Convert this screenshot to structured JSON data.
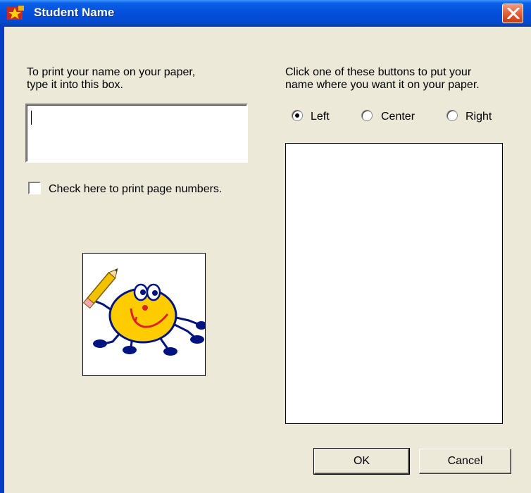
{
  "window": {
    "title": "Student Name",
    "title_icon": "app-star-icon",
    "close_icon": "close-icon"
  },
  "name_section": {
    "instruction_line1": "To print your name on your paper,",
    "instruction_line2": "type it into this box.",
    "name_value": ""
  },
  "page_numbers": {
    "label": "Check here to print page numbers.",
    "checked": false
  },
  "position_section": {
    "instruction_line1": "Click one of these buttons to put your",
    "instruction_line2": "name where you want it on your paper.",
    "options": [
      "Left",
      "Center",
      "Right"
    ],
    "selected": "Left"
  },
  "mascot": {
    "icon": "smiley-pencil-character-icon"
  },
  "buttons": {
    "ok": "OK",
    "cancel": "Cancel"
  },
  "colors": {
    "titlebar": "#0550DC",
    "dialog_bg": "#ECE9D8",
    "close_button": "#E05A32",
    "mascot_face": "#FFCC00",
    "mascot_limbs": "#00137F"
  }
}
